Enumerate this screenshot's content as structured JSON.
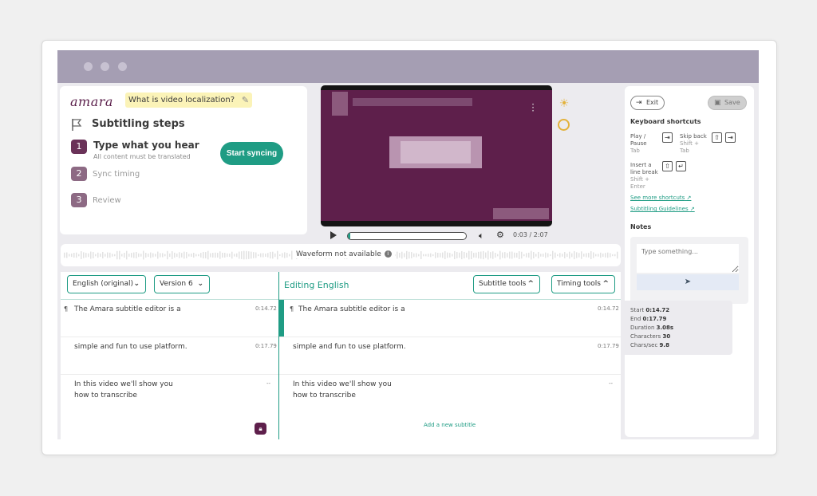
{
  "app": {
    "logo": "amara"
  },
  "header": {
    "link_label": "What is video localization?"
  },
  "steps": {
    "title": "Subtitling steps",
    "items": [
      {
        "num": "1",
        "label": "Type what you hear",
        "sub": "All content must be translated"
      },
      {
        "num": "2",
        "label": "Sync timing"
      },
      {
        "num": "3",
        "label": "Review"
      }
    ],
    "start_button": "Start syncing"
  },
  "player": {
    "time": "0:03 / 2:07",
    "progress_fraction": 0.02
  },
  "waveform": {
    "text": "Waveform not available"
  },
  "editor": {
    "language_select": "English (original)",
    "version_select": "Version 6",
    "editing_label": "Editing English",
    "subtitle_tools": "Subtitle tools",
    "timing_tools": "Timing tools",
    "rows": [
      {
        "left_text": "The Amara subtitle editor is a",
        "left_time": "0:14.72",
        "right_text": "The Amara subtitle editor is a",
        "right_time": "0:14.72"
      },
      {
        "left_text": "simple and fun to use platform.",
        "left_time": "0:17.79",
        "right_text": "simple and fun to use platform.",
        "right_time": "0:17.79"
      },
      {
        "left_text_1": "In this video we'll show you",
        "left_text_2": "how to transcribe",
        "left_time": "--",
        "right_text_1": "In this video we'll show you",
        "right_text_2": "how to transcribe",
        "right_time": "--"
      }
    ],
    "add_subtitle": "Add a new subtitle"
  },
  "right_panel": {
    "exit": "Exit",
    "save": "Save",
    "shortcuts_title": "Keyboard shortcuts",
    "play_pause_1": "Play /",
    "play_pause_2": "Pause",
    "play_pause_key": "Tab",
    "skip_back": "Skip back",
    "skip_back_key_1": "Shift +",
    "skip_back_key_2": "Tab",
    "insert_1": "Insert a",
    "insert_2": "line break",
    "insert_key_1": "Shift +",
    "insert_key_2": "Enter",
    "see_more": "See more shortcuts",
    "guidelines": "Subtitling Guidelines",
    "notes_title": "Notes",
    "notes_placeholder": "Type something..."
  },
  "tooltip": {
    "start_label": "Start",
    "start": "0:14.72",
    "end_label": "End",
    "end": "0:17.79",
    "duration_label": "Duration",
    "duration": "3.08s",
    "chars_label": "Characters",
    "chars": "30",
    "cps_label": "Chars/sec",
    "cps": "9.8"
  },
  "colors": {
    "accent": "#1f9c84",
    "brand": "#5e1f4b",
    "titlebar": "#a59eb3"
  }
}
